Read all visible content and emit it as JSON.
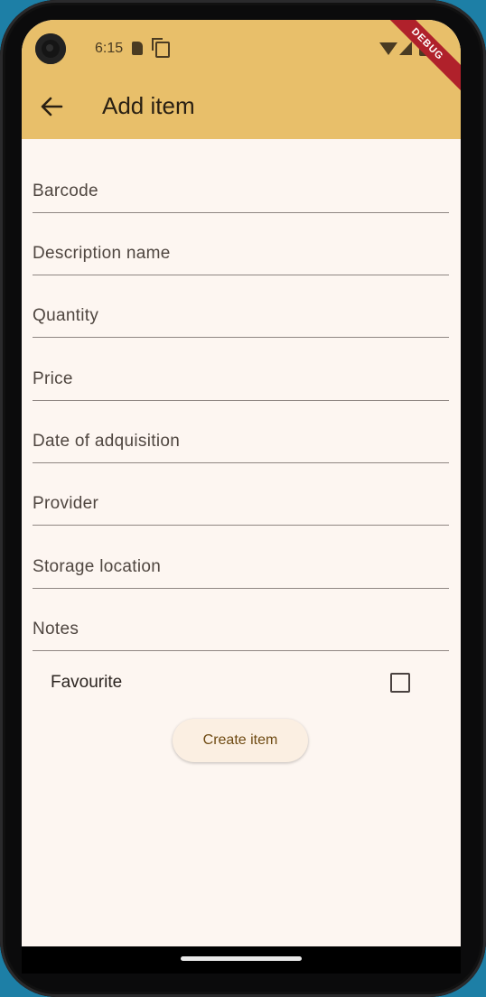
{
  "status_bar": {
    "time": "6:15",
    "icons": [
      "sd-card-icon",
      "copy-icon",
      "wifi-icon",
      "signal-icon",
      "battery-icon"
    ]
  },
  "debug_banner": "DEBUG",
  "app_bar": {
    "title": "Add item",
    "back_icon": "arrow-back-icon",
    "color": "#e8bf6a"
  },
  "form": {
    "fields": [
      {
        "label": "Barcode"
      },
      {
        "label": "Description name"
      },
      {
        "label": "Quantity"
      },
      {
        "label": "Price"
      },
      {
        "label": "Date of adquisition"
      },
      {
        "label": "Provider"
      },
      {
        "label": "Storage location"
      },
      {
        "label": "Notes"
      }
    ],
    "favourite": {
      "label": "Favourite",
      "checked": false
    },
    "submit_label": "Create item"
  },
  "colors": {
    "background": "#fdf6f1",
    "accent": "#e8bf6a",
    "button_text": "#6e4a12"
  }
}
